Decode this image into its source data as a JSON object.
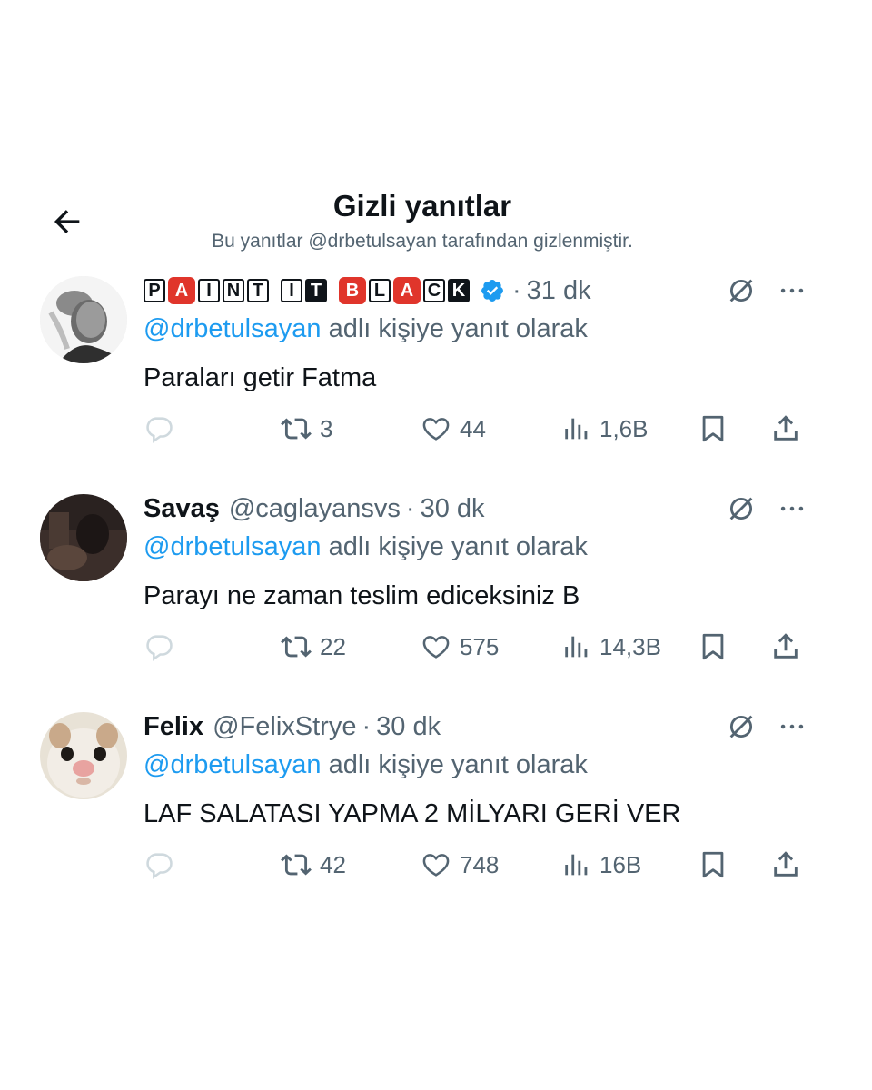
{
  "header": {
    "title": "Gizli yanıtlar",
    "subtitle": "Bu yanıtlar @drbetulsayan tarafından gizlenmiştir."
  },
  "tweets": [
    {
      "display_name": "PAINT IT BLACK",
      "name_badges": [
        "P",
        "A",
        "I",
        "N",
        "T",
        " ",
        "I",
        "T",
        " ",
        "B",
        "L",
        "A",
        "C",
        "K"
      ],
      "verified": true,
      "handle": "",
      "time": "31 dk",
      "reply_prefix": "@drbetulsayan",
      "reply_suffix": "adlı kişiye yanıt olarak",
      "text": "Paraları getir Fatma",
      "replies": "",
      "retweets": "3",
      "likes": "44",
      "views": "1,6B",
      "avatar": "man-portrait-avatar"
    },
    {
      "display_name": "Savaş",
      "verified": false,
      "handle": "@caglayansvs",
      "time": "30 dk",
      "reply_prefix": "@drbetulsayan",
      "reply_suffix": "adlı kişiye yanıt olarak",
      "text": "Parayı ne zaman teslim ediceksiniz B",
      "replies": "",
      "retweets": "22",
      "likes": "575",
      "views": "14,3B",
      "avatar": "dark-photo-avatar"
    },
    {
      "display_name": "Felix",
      "verified": false,
      "handle": "@FelixStrye",
      "time": "30 dk",
      "reply_prefix": "@drbetulsayan",
      "reply_suffix": "adlı kişiye yanıt olarak",
      "text": "LAF SALATASI YAPMA 2 MİLYARI GERİ VER",
      "replies": "",
      "retweets": "42",
      "likes": "748",
      "views": "16B",
      "avatar": "cat-avatar"
    }
  ],
  "colors": {
    "text": "#0f1419",
    "secondary": "#536471",
    "link": "#1d9bf0",
    "divider": "#e1e6ea",
    "badge_red": "#e0352b"
  },
  "icons": [
    "back-arrow-icon",
    "hide-reply-icon",
    "more-icon",
    "reply-icon",
    "retweet-icon",
    "like-icon",
    "views-icon",
    "bookmark-icon",
    "share-icon",
    "verified-badge-icon"
  ]
}
